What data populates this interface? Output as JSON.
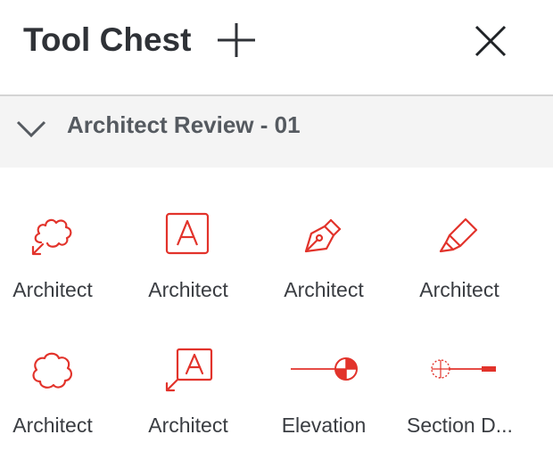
{
  "header": {
    "title": "Tool Chest",
    "add_icon": "plus-icon",
    "close_icon": "close-icon"
  },
  "section": {
    "title": "Architect Review - 01",
    "expanded": true,
    "chevron_icon": "chevron-down-icon"
  },
  "tools": [
    {
      "label": "Architect",
      "icon": "cloud-callout-icon"
    },
    {
      "label": "Architect",
      "icon": "text-box-icon"
    },
    {
      "label": "Architect",
      "icon": "pen-icon"
    },
    {
      "label": "Architect",
      "icon": "highlighter-icon"
    },
    {
      "label": "Architect",
      "icon": "cloud-icon"
    },
    {
      "label": "Architect",
      "icon": "text-callout-icon"
    },
    {
      "label": "Elevation",
      "icon": "elevation-marker-icon"
    },
    {
      "label": "Section D...",
      "icon": "section-marker-icon"
    }
  ],
  "colors": {
    "accent": "#e2332b",
    "text": "#2f3237",
    "section_bg": "#f4f4f4",
    "divider": "#d4d4d4"
  }
}
